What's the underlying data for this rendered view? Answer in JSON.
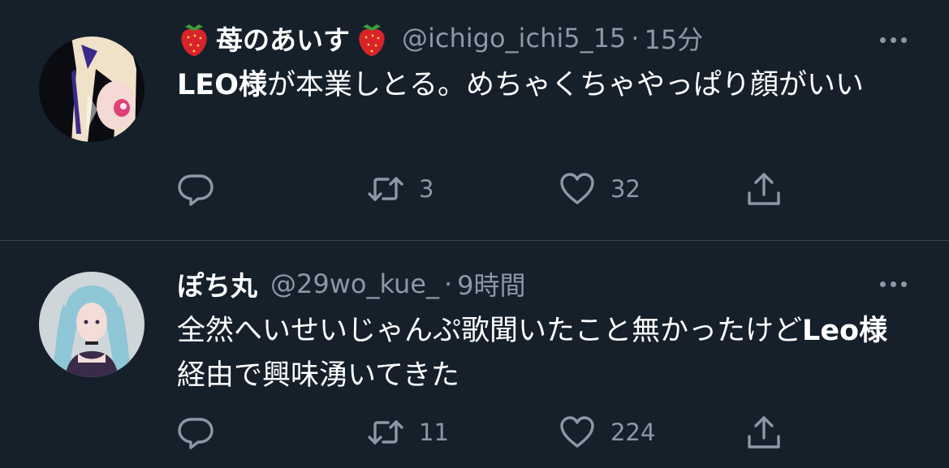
{
  "tweets": [
    {
      "display_name": "苺のあいす",
      "name_emoji_left": "strawberry-icon",
      "name_emoji_right": "strawberry-icon",
      "handle": "@ichigo_ichi5_15",
      "separator": "·",
      "time": "15分",
      "text_bold": "LEO様",
      "text_rest": "が本業しとる。めちゃくちゃやっぱり顔がいい",
      "retweets": "3",
      "likes": "32",
      "avatar_colors": {
        "hair": "#efe2c8",
        "ribbon": "#3a2a8c",
        "eye": "#e0407a",
        "bg": "#0b0b12"
      }
    },
    {
      "display_name": "ぽち丸",
      "handle": "@29wo_kue_",
      "separator": "·",
      "time": "9時間",
      "text_pre": "全然へいせいじゃんぷ歌聞いたこと無かったけど",
      "text_bold": "Leo様",
      "text_rest": "経由で興味湧いてきた",
      "retweets": "11",
      "likes": "224",
      "avatar_colors": {
        "hair": "#8fc7d6",
        "bg": "#cfd6da",
        "outfit": "#3b2b4a"
      }
    }
  ],
  "icons": [
    "reply-icon",
    "retweet-icon",
    "like-icon",
    "share-icon",
    "more-icon"
  ],
  "colors": {
    "background": "#15202b",
    "secondary_text": "#8b98a5",
    "divider": "#38444d"
  }
}
